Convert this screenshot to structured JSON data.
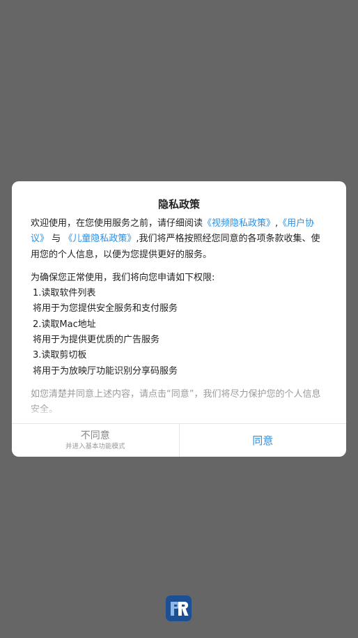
{
  "dialog": {
    "title": "隐私政策",
    "intro": {
      "part1": "欢迎使用，在您使用服务之前，请仔细阅读",
      "link_video_policy": "《视频隐私政策》",
      "comma": ",",
      "link_user_agreement": "《用户协议》",
      "and": "与",
      "link_children_policy": "《儿童隐私政策》",
      "part2": ",我们将严格按照经您同意的各项条款收集、使用您的个人信息，以便为您提供更好的服务。"
    },
    "permissions_intro": "为确保您正常使用，我们将向您申请如下权限:",
    "permissions": [
      "1.读取软件列表",
      "将用于为您提供安全服务和支付服务",
      "2.读取Mac地址",
      "将用于为提供更优质的广告服务",
      "3.读取剪切板",
      "将用于为放映厅功能识别分享码服务"
    ],
    "footer_note": "如您清楚并同意上述内容，请点击“同意”，我们将尽力保护您的个人信息安全。",
    "decline_label": "不同意",
    "decline_sublabel": "并进入基本功能模式",
    "agree_label": "同意"
  },
  "colors": {
    "overlay": "#666666",
    "link": "#2e8ee0",
    "logo": "#1d4f94"
  },
  "app_logo": {
    "icon": "app-logo-icon"
  }
}
